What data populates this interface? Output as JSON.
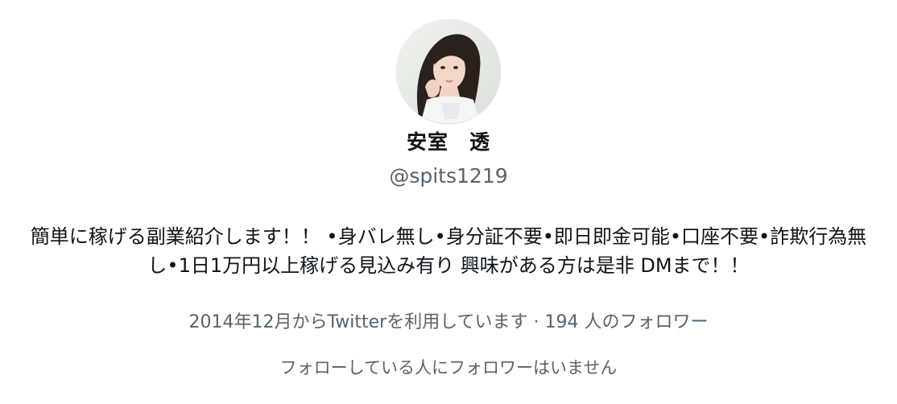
{
  "profile": {
    "avatar_alt": "profile-photo",
    "display_name": "安室　透",
    "handle": "@spits1219",
    "bio": "簡単に稼げる副業紹介します！！ •身バレ無し•身分証不要•即日即金可能•口座不要•詐欺行為無し•1日1万円以上稼げる見込み有り 興味がある方は是非 DMまで！！",
    "meta_line": "2014年12月からTwitterを利用しています · 194 人のフォロワー",
    "relation_line": "フォローしている人にフォロワーはいません"
  },
  "colors": {
    "text_primary": "#0f1419",
    "text_secondary": "#536471",
    "background": "#ffffff"
  }
}
